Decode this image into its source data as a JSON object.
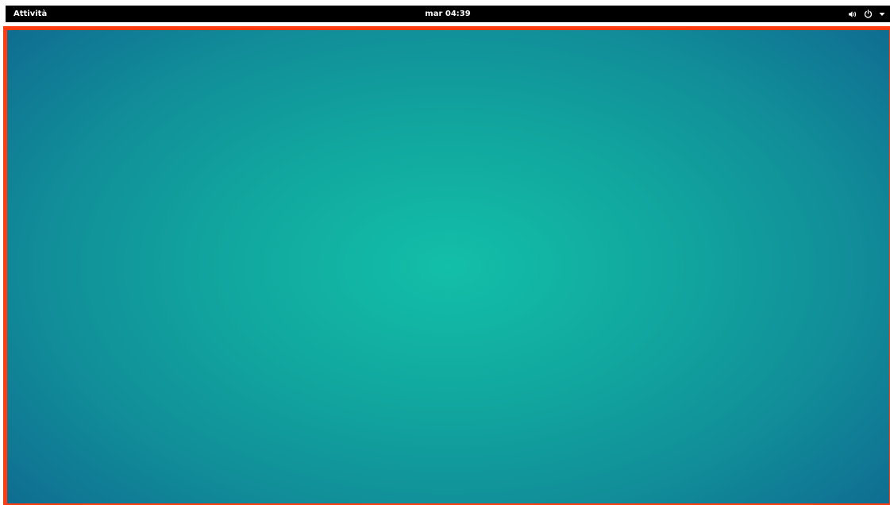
{
  "top_bar": {
    "activities_label": "Attività",
    "clock": "mar 04:39",
    "system_icons": [
      "volume-icon",
      "power-icon",
      "chevron-down-icon"
    ]
  },
  "desktop": {
    "highlight_color": "#ff3b12",
    "wallpaper_colors": [
      "#13bfa8",
      "#11a79f",
      "#118e99",
      "#0f6f92"
    ]
  }
}
